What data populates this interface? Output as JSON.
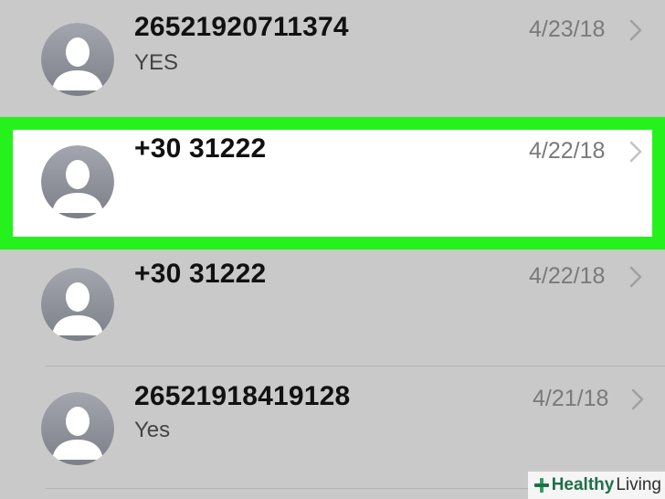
{
  "conversations": [
    {
      "name": "26521920711374",
      "preview": "YES",
      "date": "4/23/18",
      "selected": false
    },
    {
      "name": "+30 31222",
      "preview": "",
      "date": "4/22/18",
      "selected": true
    },
    {
      "name": "+30 31222",
      "preview": "",
      "date": "4/22/18",
      "selected": false
    },
    {
      "name": "26521918419128",
      "preview": "Yes",
      "date": "4/21/18",
      "selected": false
    }
  ],
  "icons": {
    "avatar": "contact-silhouette-icon",
    "disclosure": "chevron-right-icon",
    "watermark_mark": "plus-icon"
  },
  "colors": {
    "highlight": "#25f11c",
    "list_background": "#c9c9c9",
    "selected_background": "#ffffff",
    "date_text": "#7a7a7a",
    "name_text": "#111111",
    "watermark_green": "#1f6f4a"
  },
  "watermark": {
    "part1": "Healthy",
    "part2": "Living"
  }
}
